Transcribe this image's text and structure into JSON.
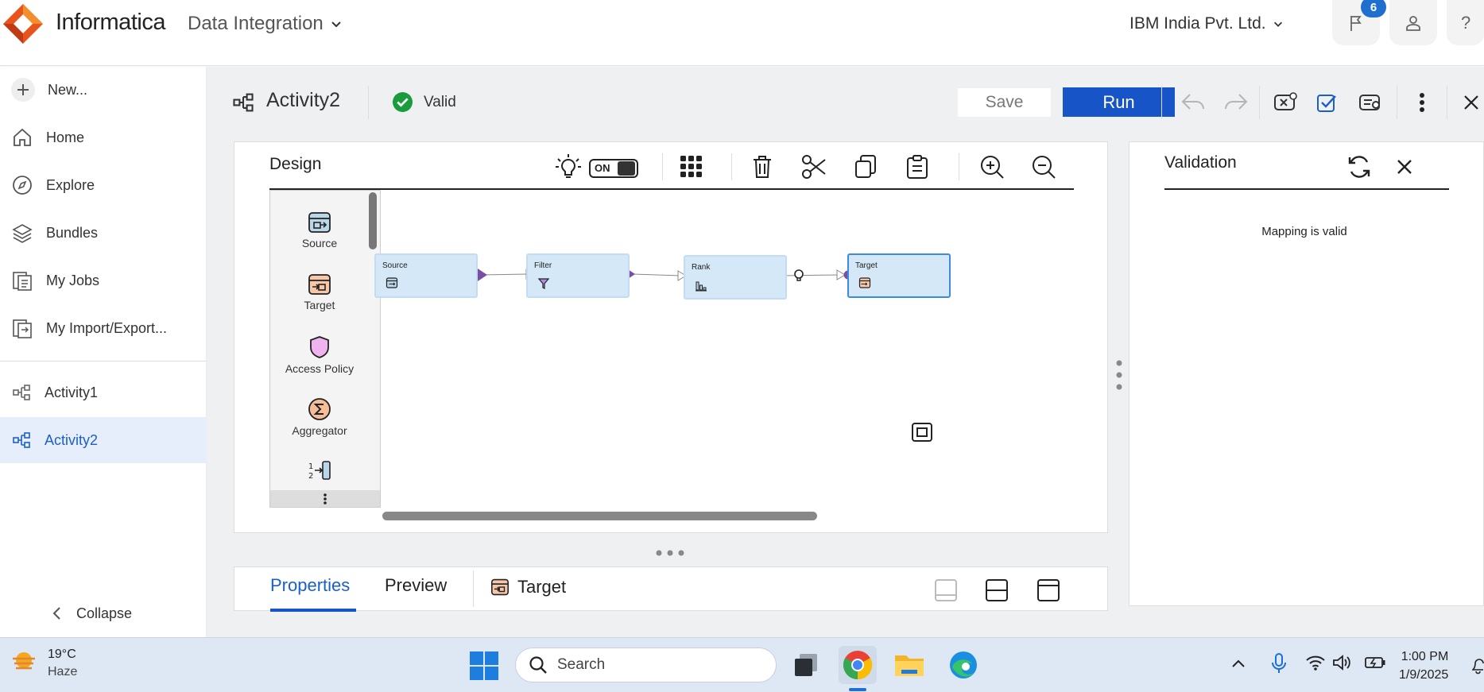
{
  "header": {
    "brand": "Informatica",
    "product": "Data Integration",
    "org": "IBM India Pvt. Ltd.",
    "notif_count": "6",
    "help": "?"
  },
  "sidebar": {
    "new_label": "New...",
    "items": [
      {
        "label": "Home"
      },
      {
        "label": "Explore"
      },
      {
        "label": "Bundles"
      },
      {
        "label": "My Jobs"
      },
      {
        "label": "My Import/Export..."
      }
    ],
    "recent": [
      {
        "label": "Activity1"
      },
      {
        "label": "Activity2"
      }
    ],
    "collapse_label": "Collapse"
  },
  "editor": {
    "title": "Activity2",
    "status": "Valid",
    "save_label": "Save",
    "run_label": "Run"
  },
  "design": {
    "title": "Design",
    "toggle_label": "ON",
    "palette": [
      {
        "label": "Source",
        "icon": "source-icon"
      },
      {
        "label": "Target",
        "icon": "target-icon"
      },
      {
        "label": "Access Policy",
        "icon": "shield-icon"
      },
      {
        "label": "Aggregator",
        "icon": "sigma-icon"
      }
    ],
    "nodes": [
      {
        "label": "Source",
        "icon": "source-icon"
      },
      {
        "label": "Filter",
        "icon": "funnel-icon"
      },
      {
        "label": "Rank",
        "icon": "bar-chart-icon"
      },
      {
        "label": "Target",
        "icon": "target-icon"
      }
    ]
  },
  "validation": {
    "title": "Validation",
    "message": "Mapping is valid"
  },
  "bottom": {
    "tab_properties": "Properties",
    "tab_preview": "Preview",
    "selected_object": "Target"
  },
  "taskbar": {
    "temp": "19°C",
    "condition": "Haze",
    "search_placeholder": "Search",
    "time": "1:00 PM",
    "date": "1/9/2025"
  },
  "colors": {
    "accent": "#1754c8",
    "valid_green": "#1a9b3c",
    "logo_orange": "#e8541b",
    "node_fill": "#d5e8f8",
    "port_purple": "#7a4fa3"
  }
}
